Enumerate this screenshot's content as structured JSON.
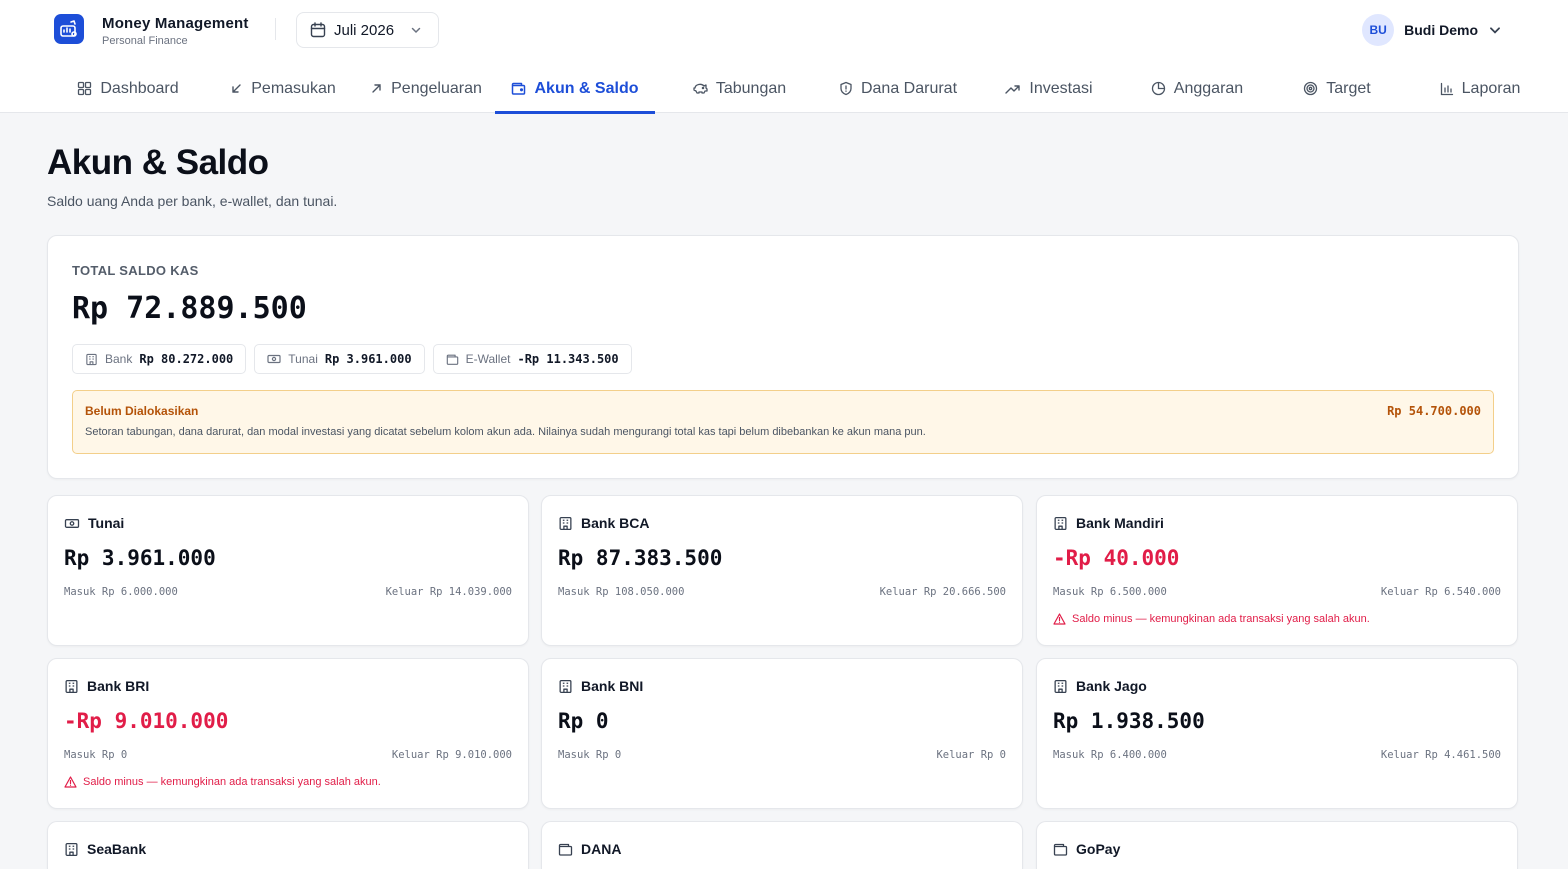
{
  "app": {
    "title": "Money Management",
    "subtitle": "Personal Finance"
  },
  "month": {
    "label": "Juli 2026"
  },
  "user": {
    "initials": "BU",
    "name": "Budi Demo"
  },
  "nav": [
    {
      "label": "Dashboard",
      "icon": "grid-icon"
    },
    {
      "label": "Pemasukan",
      "icon": "arrow-down-left-icon"
    },
    {
      "label": "Pengeluaran",
      "icon": "arrow-up-right-icon"
    },
    {
      "label": "Akun & Saldo",
      "icon": "wallet-icon",
      "active": true
    },
    {
      "label": "Tabungan",
      "icon": "piggy-bank-icon"
    },
    {
      "label": "Dana Darurat",
      "icon": "shield-icon"
    },
    {
      "label": "Investasi",
      "icon": "trending-up-icon"
    },
    {
      "label": "Anggaran",
      "icon": "pie-chart-icon"
    },
    {
      "label": "Target",
      "icon": "target-icon"
    },
    {
      "label": "Laporan",
      "icon": "bar-chart-icon"
    }
  ],
  "page": {
    "title": "Akun & Saldo",
    "subtitle": "Saldo uang Anda per bank, e-wallet, dan tunai."
  },
  "total": {
    "label": "TOTAL SALDO KAS",
    "value": "Rp 72.889.500",
    "chips": [
      {
        "label": "Bank",
        "amount": "Rp 80.272.000",
        "icon": "bank-icon"
      },
      {
        "label": "Tunai",
        "amount": "Rp 3.961.000",
        "icon": "cash-icon"
      },
      {
        "label": "E-Wallet",
        "amount": "-Rp 11.343.500",
        "icon": "wallet-icon"
      }
    ],
    "notice": {
      "title": "Belum Dialokasikan",
      "amount": "Rp 54.700.000",
      "text": "Setoran tabungan, dana darurat, dan modal investasi yang dicatat sebelum kolom akun ada. Nilainya sudah mengurangi total kas tapi belum dibebankan ke akun mana pun."
    }
  },
  "accounts": [
    {
      "name": "Tunai",
      "icon": "cash-icon",
      "balance": "Rp 3.961.000",
      "negative": false,
      "in": "Masuk Rp 6.000.000",
      "out": "Keluar Rp 14.039.000",
      "warning": ""
    },
    {
      "name": "Bank BCA",
      "icon": "bank-icon",
      "balance": "Rp 87.383.500",
      "negative": false,
      "in": "Masuk Rp 108.050.000",
      "out": "Keluar Rp 20.666.500",
      "warning": ""
    },
    {
      "name": "Bank Mandiri",
      "icon": "bank-icon",
      "balance": "-Rp 40.000",
      "negative": true,
      "in": "Masuk Rp 6.500.000",
      "out": "Keluar Rp 6.540.000",
      "warning": "Saldo minus — kemungkinan ada transaksi yang salah akun."
    },
    {
      "name": "Bank BRI",
      "icon": "bank-icon",
      "balance": "-Rp 9.010.000",
      "negative": true,
      "in": "Masuk Rp 0",
      "out": "Keluar Rp 9.010.000",
      "warning": "Saldo minus — kemungkinan ada transaksi yang salah akun."
    },
    {
      "name": "Bank BNI",
      "icon": "bank-icon",
      "balance": "Rp 0",
      "negative": false,
      "in": "Masuk Rp 0",
      "out": "Keluar Rp 0",
      "warning": ""
    },
    {
      "name": "Bank Jago",
      "icon": "bank-icon",
      "balance": "Rp 1.938.500",
      "negative": false,
      "in": "Masuk Rp 6.400.000",
      "out": "Keluar Rp 4.461.500",
      "warning": ""
    },
    {
      "name": "SeaBank",
      "icon": "bank-icon",
      "balance": "",
      "negative": false,
      "in": "",
      "out": "",
      "warning": ""
    },
    {
      "name": "DANA",
      "icon": "wallet-icon",
      "balance": "",
      "negative": false,
      "in": "",
      "out": "",
      "warning": ""
    },
    {
      "name": "GoPay",
      "icon": "wallet-icon",
      "balance": "",
      "negative": false,
      "in": "",
      "out": "",
      "warning": ""
    }
  ],
  "colors": {
    "accent": "#1d4ed8",
    "negative": "#e11d48",
    "warning": "#b45309"
  }
}
